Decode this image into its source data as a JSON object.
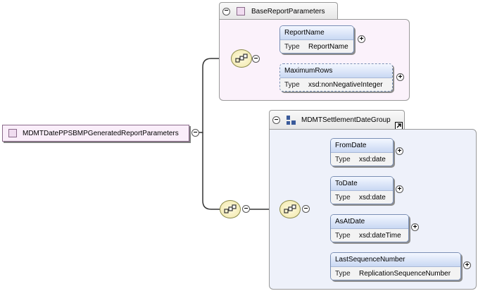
{
  "root": {
    "label": "MDMTDatePPSBMPGeneratedReportParameters"
  },
  "base_group": {
    "title": "BaseReportParameters",
    "elements": [
      {
        "name": "ReportName",
        "type_label": "Type",
        "type": "ReportName",
        "optional": false
      },
      {
        "name": "MaximumRows",
        "type_label": "Type",
        "type": "xsd:nonNegativeInteger",
        "optional": true
      }
    ]
  },
  "settlement_group": {
    "title": "MDMTSettlementDateGroup",
    "elements": [
      {
        "name": "FromDate",
        "type_label": "Type",
        "type": "xsd:date"
      },
      {
        "name": "ToDate",
        "type_label": "Type",
        "type": "xsd:date"
      },
      {
        "name": "AsAtDate",
        "type_label": "Type",
        "type": "xsd:dateTime"
      },
      {
        "name": "LastSequenceNumber",
        "type_label": "Type",
        "type": "ReplicationSequenceNumber"
      }
    ]
  },
  "symbols": {
    "collapse": "−",
    "expand": "+"
  },
  "colors": {
    "element_header": "#c9d8f3",
    "base_group_bg": "#fbf2fb",
    "settlement_group_bg": "#eef1fa",
    "sequence_fill": "#f0e6a8"
  }
}
